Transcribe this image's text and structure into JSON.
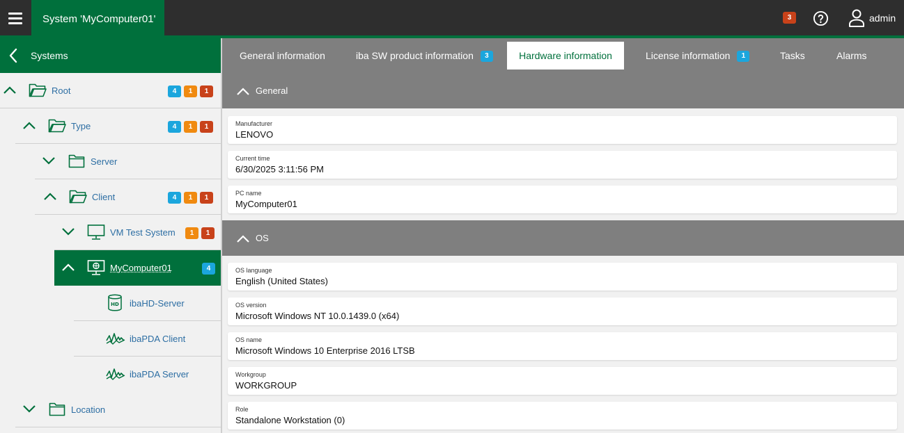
{
  "topbar": {
    "system_tab": "System 'MyComputer01'",
    "notification_count": "3",
    "user_name": "admin"
  },
  "sidebar": {
    "title": "Systems",
    "tree": [
      {
        "label": "Root",
        "badges": {
          "blue": "4",
          "orange": "1",
          "red": "1"
        }
      },
      {
        "label": "Type",
        "badges": {
          "blue": "4",
          "orange": "1",
          "red": "1"
        }
      },
      {
        "label": "Server"
      },
      {
        "label": "Client",
        "badges": {
          "blue": "4",
          "orange": "1",
          "red": "1"
        }
      },
      {
        "label": "VM Test System",
        "badges": {
          "orange": "1",
          "red": "1"
        }
      },
      {
        "label": "MyComputer01",
        "badges": {
          "blue": "4"
        },
        "selected": true
      },
      {
        "label": "ibaHD-Server",
        "icon_text": "HD"
      },
      {
        "label": "ibaPDA Client"
      },
      {
        "label": "ibaPDA Server"
      },
      {
        "label": "Location"
      }
    ]
  },
  "tabs": [
    {
      "label": "General information"
    },
    {
      "label": "iba SW product information",
      "badge": "3"
    },
    {
      "label": "Hardware information",
      "active": true
    },
    {
      "label": "License information",
      "badge": "1"
    },
    {
      "label": "Tasks"
    },
    {
      "label": "Alarms"
    }
  ],
  "sections": {
    "general": {
      "title": "General",
      "fields": [
        {
          "label": "Manufacturer",
          "value": "LENOVO"
        },
        {
          "label": "Current time",
          "value": "6/30/2025 3:11:56 PM"
        },
        {
          "label": "PC name",
          "value": "MyComputer01"
        }
      ]
    },
    "os": {
      "title": "OS",
      "fields": [
        {
          "label": "OS language",
          "value": "English (United States)"
        },
        {
          "label": "OS version",
          "value": "Microsoft Windows NT 10.0.1439.0 (x64)"
        },
        {
          "label": "OS name",
          "value": "Microsoft Windows 10 Enterprise 2016 LTSB"
        },
        {
          "label": "Workgroup",
          "value": "WORKGROUP"
        },
        {
          "label": "Role",
          "value": "Standalone Workstation (0)"
        }
      ]
    }
  },
  "colors": {
    "brand_green": "#00703c",
    "topbar": "#2e2e2e",
    "tab_bar_gray": "#7f7f7f",
    "badge_blue": "#1ba6dd",
    "badge_orange": "#f08a10",
    "badge_red": "#c8421a",
    "link_blue": "#2d6ea3"
  },
  "icons": {
    "menu": "hamburger-icon",
    "help": "help-icon",
    "user": "user-icon",
    "back": "chevron-left-icon",
    "folder": "folder-icon",
    "computer": "monitor-icon",
    "database": "hd-database-icon",
    "signal": "signal-wave-icon"
  }
}
